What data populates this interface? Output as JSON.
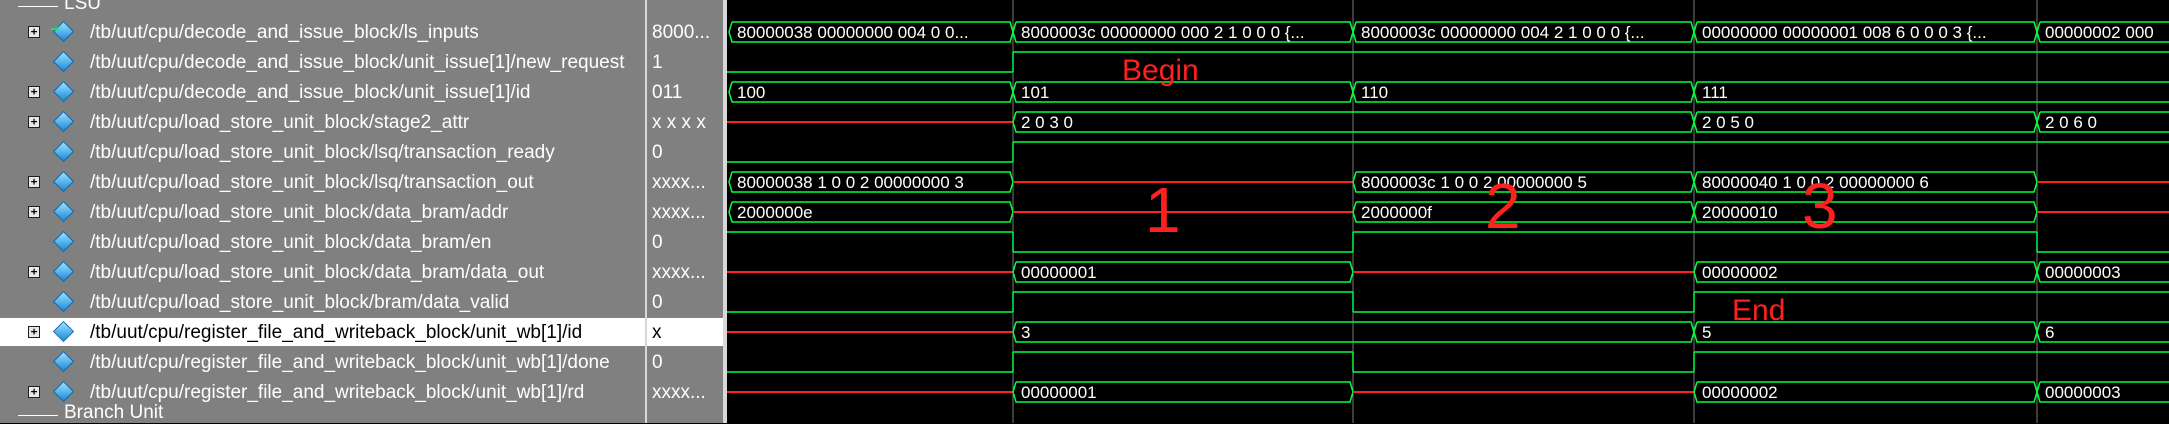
{
  "groups": {
    "top_label": "LSU",
    "bottom_label": "Branch Unit"
  },
  "signals": [
    {
      "name": "/tb/uut/cpu/decode_and_issue_block/ls_inputs",
      "value": "8000...",
      "expand": true,
      "icon": "bus-input-icon"
    },
    {
      "name": "/tb/uut/cpu/decode_and_issue_block/unit_issue[1]/new_request",
      "value": "1",
      "expand": false,
      "icon": "signal-icon"
    },
    {
      "name": "/tb/uut/cpu/decode_and_issue_block/unit_issue[1]/id",
      "value": "011",
      "expand": true,
      "icon": "signal-icon"
    },
    {
      "name": "/tb/uut/cpu/load_store_unit_block/stage2_attr",
      "value": "x x x x",
      "expand": true,
      "icon": "signal-icon"
    },
    {
      "name": "/tb/uut/cpu/load_store_unit_block/lsq/transaction_ready",
      "value": "0",
      "expand": false,
      "icon": "signal-icon"
    },
    {
      "name": "/tb/uut/cpu/load_store_unit_block/lsq/transaction_out",
      "value": "xxxx...",
      "expand": true,
      "icon": "signal-icon"
    },
    {
      "name": "/tb/uut/cpu/load_store_unit_block/data_bram/addr",
      "value": "xxxx...",
      "expand": true,
      "icon": "signal-icon"
    },
    {
      "name": "/tb/uut/cpu/load_store_unit_block/data_bram/en",
      "value": "0",
      "expand": false,
      "icon": "signal-icon"
    },
    {
      "name": "/tb/uut/cpu/load_store_unit_block/data_bram/data_out",
      "value": "xxxx...",
      "expand": true,
      "icon": "signal-icon"
    },
    {
      "name": "/tb/uut/cpu/load_store_unit_block/bram/data_valid",
      "value": "0",
      "expand": false,
      "icon": "signal-icon"
    },
    {
      "name": "/tb/uut/cpu/register_file_and_writeback_block/unit_wb[1]/id",
      "value": "x",
      "expand": true,
      "icon": "signal-icon",
      "selected": true
    },
    {
      "name": "/tb/uut/cpu/register_file_and_writeback_block/unit_wb[1]/done",
      "value": "0",
      "expand": false,
      "icon": "signal-icon"
    },
    {
      "name": "/tb/uut/cpu/register_file_and_writeback_block/unit_wb[1]/rd",
      "value": "xxxx...",
      "expand": true,
      "icon": "signal-icon"
    }
  ],
  "wave_labels": {
    "row0": [
      "80000038 00000000 004 0 0...",
      "8000003c 00000000 000 2 1 0 0 0 {...",
      "8000003c 00000000 004 2 1 0 0 0 {...",
      "00000000 00000001 008 6 0 0 0 3 {...",
      "00000002 000"
    ],
    "row2": [
      "100",
      "101",
      "110",
      "111"
    ],
    "row3": [
      "2 0 3 0",
      "2 0 5 0",
      "2 0 6 0"
    ],
    "row5": [
      "80000038 1 0 0 2 00000000 3",
      "8000003c 1 0 0 2 00000000 5",
      "80000040 1 0 0 2 00000000 6"
    ],
    "row6": [
      "2000000e",
      "2000000f",
      "20000010"
    ],
    "row8": [
      "00000001",
      "00000002",
      "00000003"
    ],
    "row10": [
      "3",
      "5",
      "6"
    ],
    "row12": [
      "00000001",
      "00000002",
      "00000003"
    ]
  },
  "annotations": {
    "begin": "Begin",
    "end": "End",
    "n1": "1",
    "n2": "2",
    "n3": "3"
  },
  "colors": {
    "wave_valid": "#00ff40",
    "wave_undefined": "#ff2020",
    "cursor_lines": "#7a7a7a",
    "annotation": "#ff2020",
    "panel_bg": "#808080",
    "selected_bg": "#ffffff"
  }
}
